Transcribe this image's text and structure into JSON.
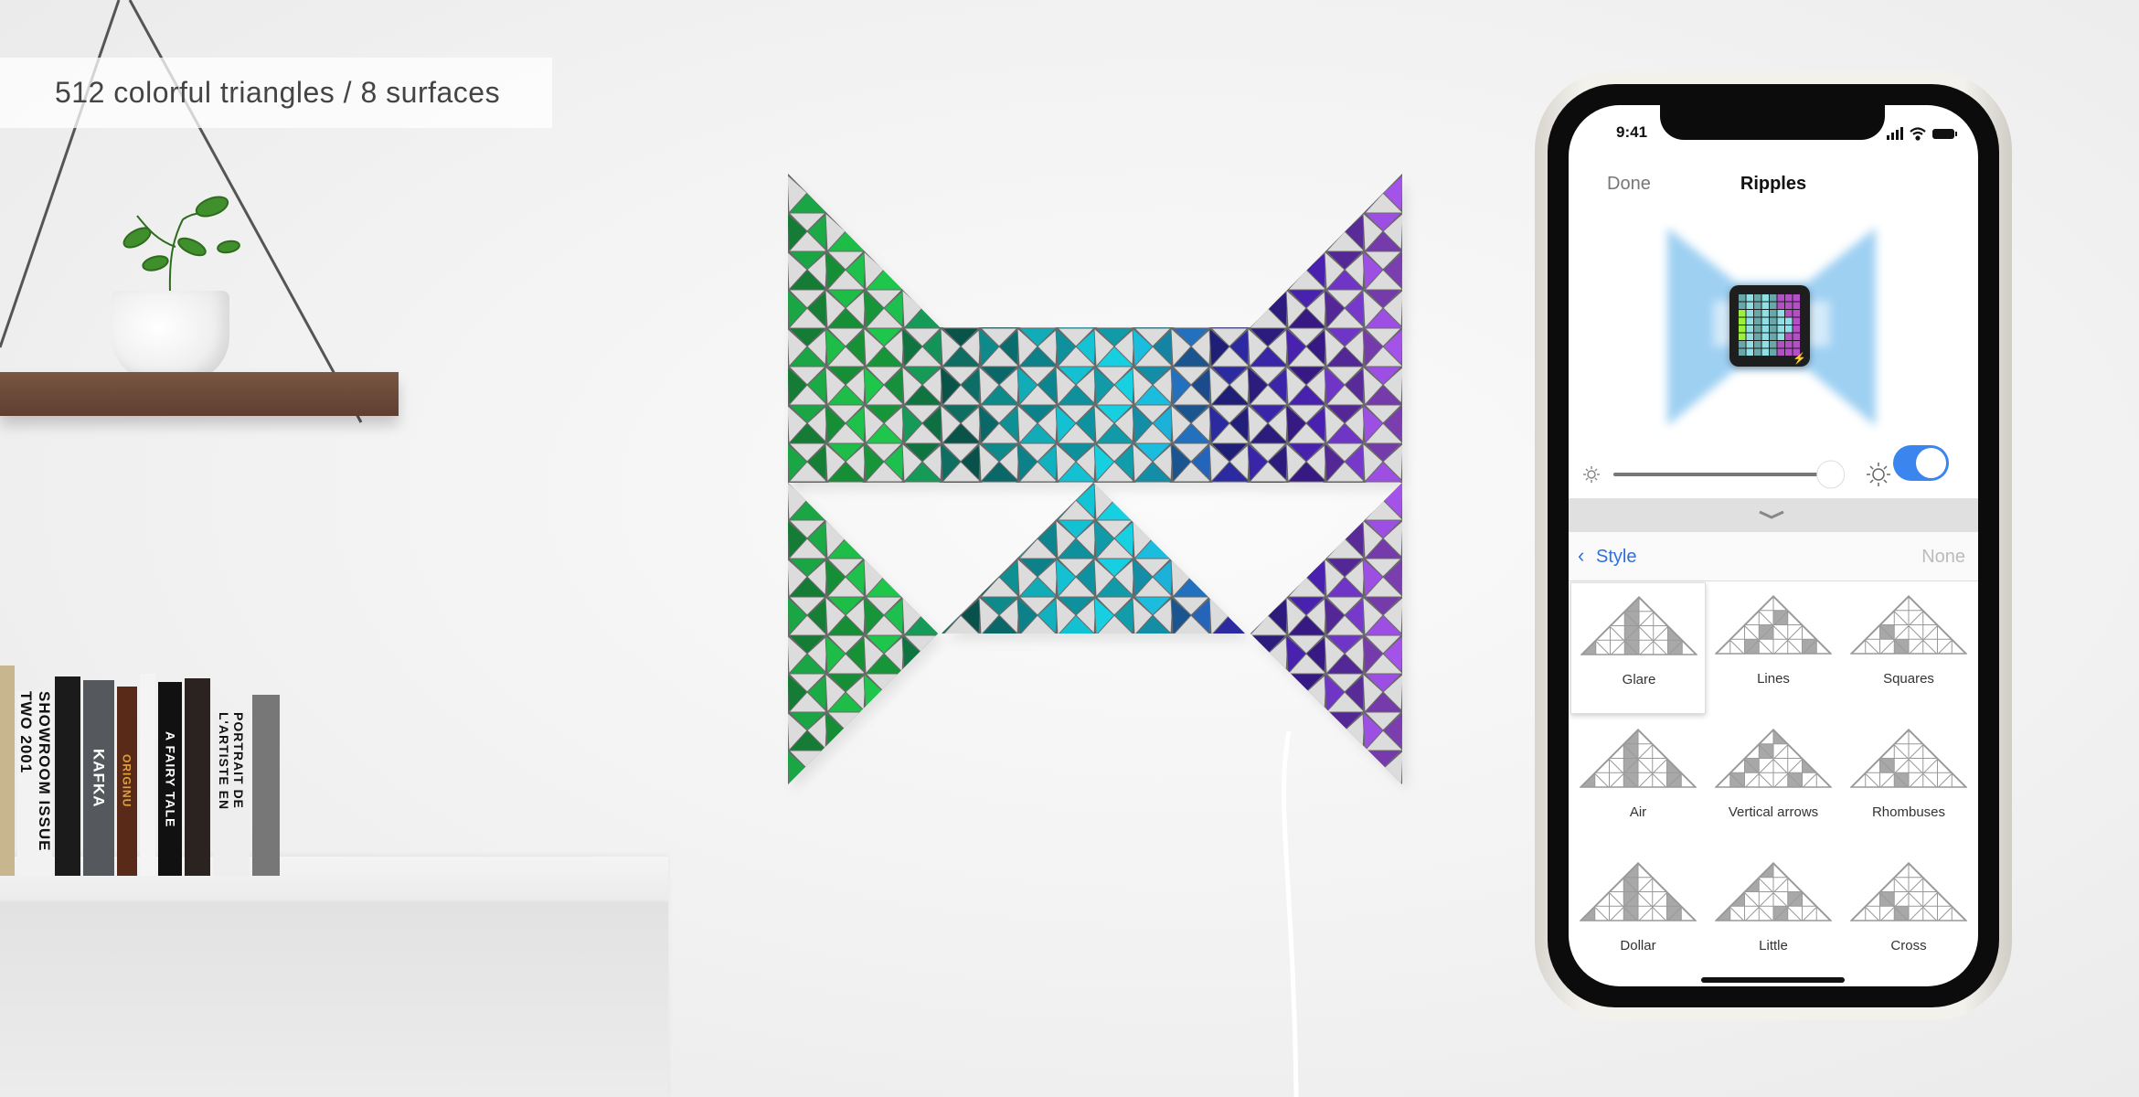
{
  "caption": "512 colorful triangles / 8 surfaces",
  "book_spines": [
    "SHOWROOM ISSUE TWO 2001",
    "KAFKA",
    "ORIGINU",
    "A FAIRY TALE",
    "PORTRAIT DE L'ARTISTE EN"
  ],
  "panel": {
    "surfaces": 8,
    "triangles": 512,
    "gradient": [
      "#1a9a45",
      "#20d04a",
      "#0c6b62",
      "#12b8c8",
      "#18d8ea",
      "#2a2aa0",
      "#4b20b0",
      "#b45cf2"
    ],
    "tile_gray": "#dcdcdc"
  },
  "phone": {
    "status": {
      "time": "9:41",
      "icons": [
        "signal-icon",
        "wifi-icon",
        "battery-icon"
      ]
    },
    "nav": {
      "done": "Done",
      "title": "Ripples"
    },
    "brightness": {
      "value": 0.97
    },
    "power_toggle": {
      "on": true,
      "color": "#3b86ee"
    },
    "style_row": {
      "back_label": "Style",
      "value": "None"
    },
    "styles": [
      {
        "label": "Glare",
        "selected": true
      },
      {
        "label": "Lines"
      },
      {
        "label": "Squares"
      },
      {
        "label": "Air"
      },
      {
        "label": "Vertical arrows"
      },
      {
        "label": "Rhombuses"
      },
      {
        "label": "Dollar"
      },
      {
        "label": "Little"
      },
      {
        "label": "Cross"
      }
    ]
  }
}
